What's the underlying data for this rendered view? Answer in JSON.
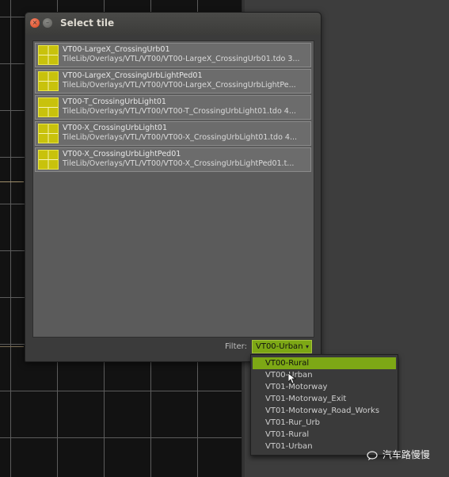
{
  "dialog": {
    "title": "Select tile",
    "close_glyph": "×",
    "minimize_glyph": "–"
  },
  "tiles": [
    {
      "name": "VT00-LargeX_CrossingUrb01",
      "path": "TileLib/Overlays/VTL/VT00/VT00-LargeX_CrossingUrb01.tdo  3...",
      "thumb_icon": "large-x-crossing-icon"
    },
    {
      "name": "VT00-LargeX_CrossingUrbLightPed01",
      "path": "TileLib/Overlays/VTL/VT00/VT00-LargeX_CrossingUrbLightPe...",
      "thumb_icon": "large-x-crossing-icon"
    },
    {
      "name": "VT00-T_CrossingUrbLight01",
      "path": "TileLib/Overlays/VTL/VT00/VT00-T_CrossingUrbLight01.tdo  4...",
      "thumb_icon": "t-crossing-icon"
    },
    {
      "name": "VT00-X_CrossingUrbLight01",
      "path": "TileLib/Overlays/VTL/VT00/VT00-X_CrossingUrbLight01.tdo  4...",
      "thumb_icon": "x-crossing-icon"
    },
    {
      "name": "VT00-X_CrossingUrbLightPed01",
      "path": "TileLib/Overlays/VTL/VT00/VT00-X_CrossingUrbLightPed01.t...",
      "thumb_icon": "x-crossing-icon"
    }
  ],
  "filter": {
    "label": "Filter:",
    "value": "VT00-Urban",
    "arrow_glyph": "▾",
    "options": [
      "VT00-Rural",
      "VT00-Urban",
      "VT01-Motorway",
      "VT01-Motorway_Exit",
      "VT01-Motorway_Road_Works",
      "VT01-Rur_Urb",
      "VT01-Rural",
      "VT01-Urban"
    ],
    "highlighted": "VT00-Rural"
  },
  "watermark": {
    "text": "汽车路慢慢"
  },
  "colors": {
    "accent": "#7da815",
    "tile_thumb": "#c8c20c",
    "close_button": "#e0583a"
  }
}
